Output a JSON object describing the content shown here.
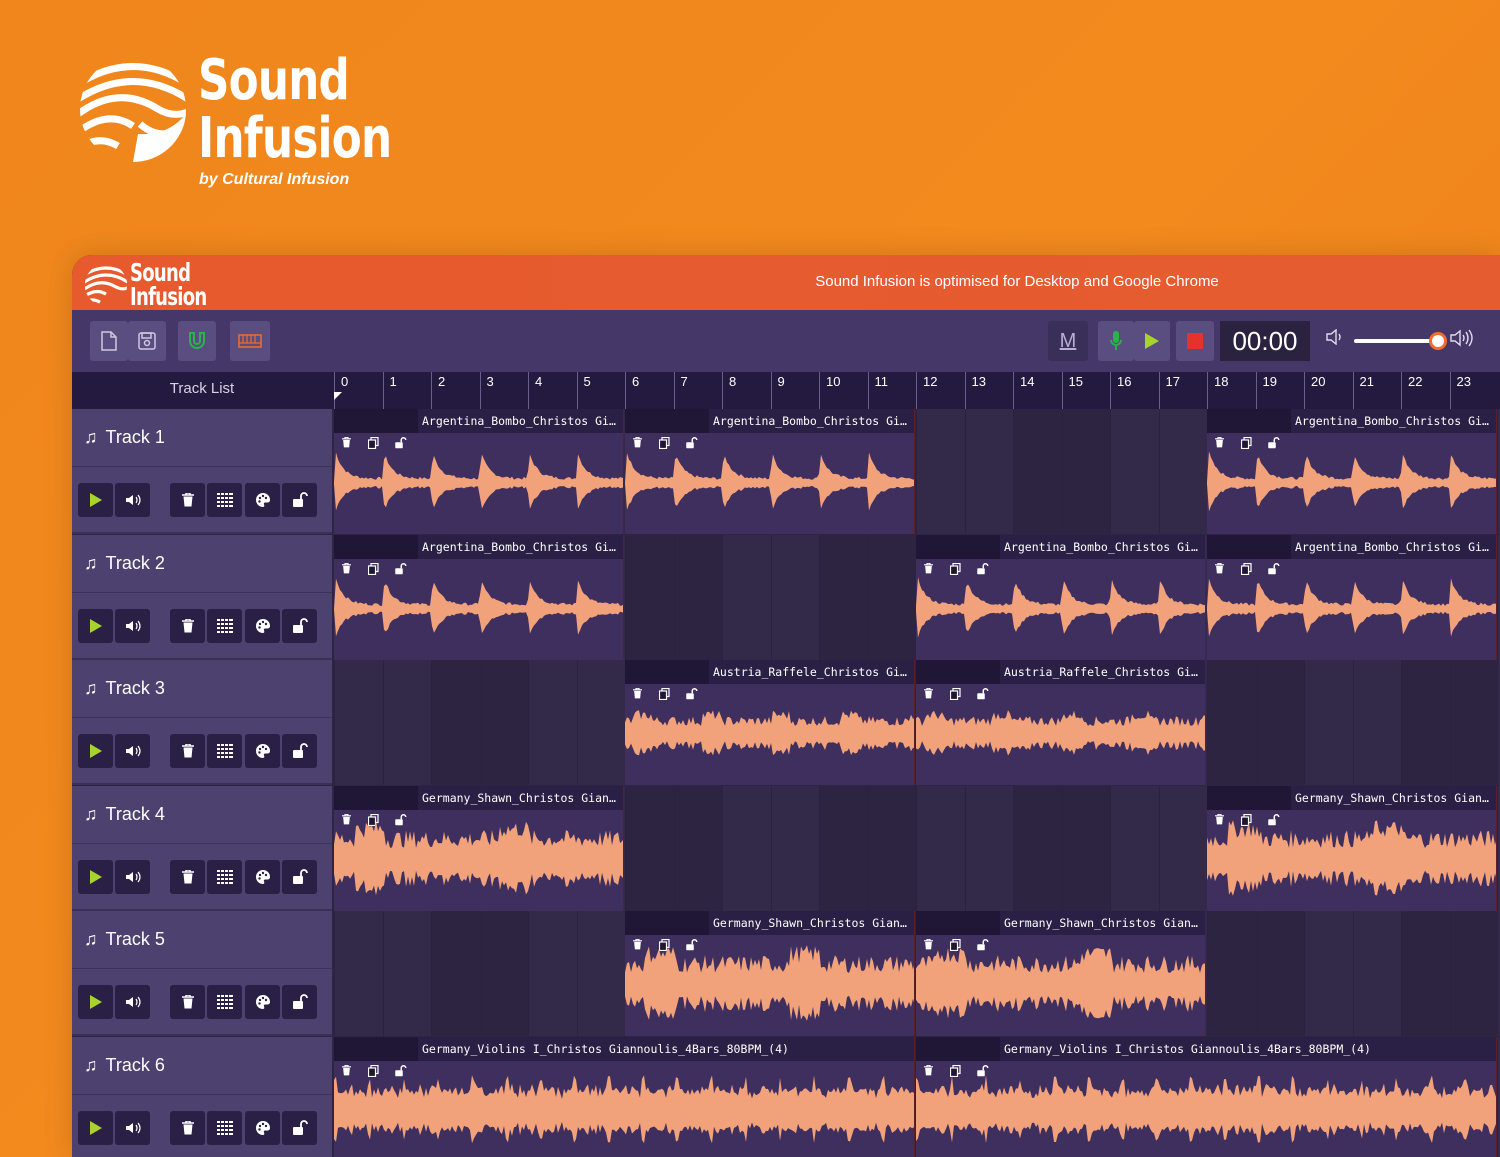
{
  "hero": {
    "brand_line1": "Sound",
    "brand_line2": "Infusion",
    "byline": "by Cultural Infusion"
  },
  "banner": {
    "logo_line1": "Sound",
    "logo_line2": "Infusion",
    "message": "Sound Infusion is optimised for Desktop and Google Chrome"
  },
  "toolbar": {
    "new_icon": "file-icon",
    "save_icon": "save-icon",
    "magnet_icon": "magnet-icon",
    "keyboard_icon": "keyboard-icon",
    "metronome_label": "M",
    "time": "00:00",
    "volume_level": 0.9,
    "accent_green": "#2ab34a",
    "accent_play": "#a8d32d",
    "accent_stop": "#e5322d"
  },
  "timeline": {
    "header_label": "Track List",
    "bars": [
      "0",
      "1",
      "2",
      "3",
      "4",
      "5",
      "6",
      "7",
      "8",
      "9",
      "10",
      "11",
      "12",
      "13",
      "14",
      "15",
      "16",
      "17",
      "18",
      "19",
      "20",
      "21",
      "22",
      "23"
    ]
  },
  "tracks": [
    {
      "name": "Track 1"
    },
    {
      "name": "Track 2"
    },
    {
      "name": "Track 3"
    },
    {
      "name": "Track 4"
    },
    {
      "name": "Track 5"
    },
    {
      "name": "Track 6"
    }
  ],
  "clips": {
    "t1c1": "Argentina_Bombo_Christos Giann…",
    "t1c2": "Argentina_Bombo_Christos Giann…",
    "t1c3": "Argentina_Bombo_Christos Giann…",
    "t2c1": "Argentina_Bombo_Christos Giann…",
    "t2c2": "Argentina_Bombo_Christos Giann…",
    "t2c3": "Argentina_Bombo_Christos Giann…",
    "t3c1": "Austria_Raffele_Christos Giann…",
    "t3c2": "Austria_Raffele_Christos Giann…",
    "t4c1": "Germany_Shawn_Christos Giannou…",
    "t4c2": "Germany_Shawn_Christos Giannou…",
    "t5c1": "Germany_Shawn_Christos Giannou…",
    "t5c2": "Germany_Shawn_Christos Giannou…",
    "t6c1": "Germany_Violins I_Christos Giannoulis_4Bars_80BPM_(4)",
    "t6c2": "Germany_Violins I_Christos Giannoulis_4Bars_80BPM_(4)"
  },
  "colors": {
    "waveform": "#f2a27a",
    "banner": "#e55c30",
    "background": "#f0861c"
  }
}
